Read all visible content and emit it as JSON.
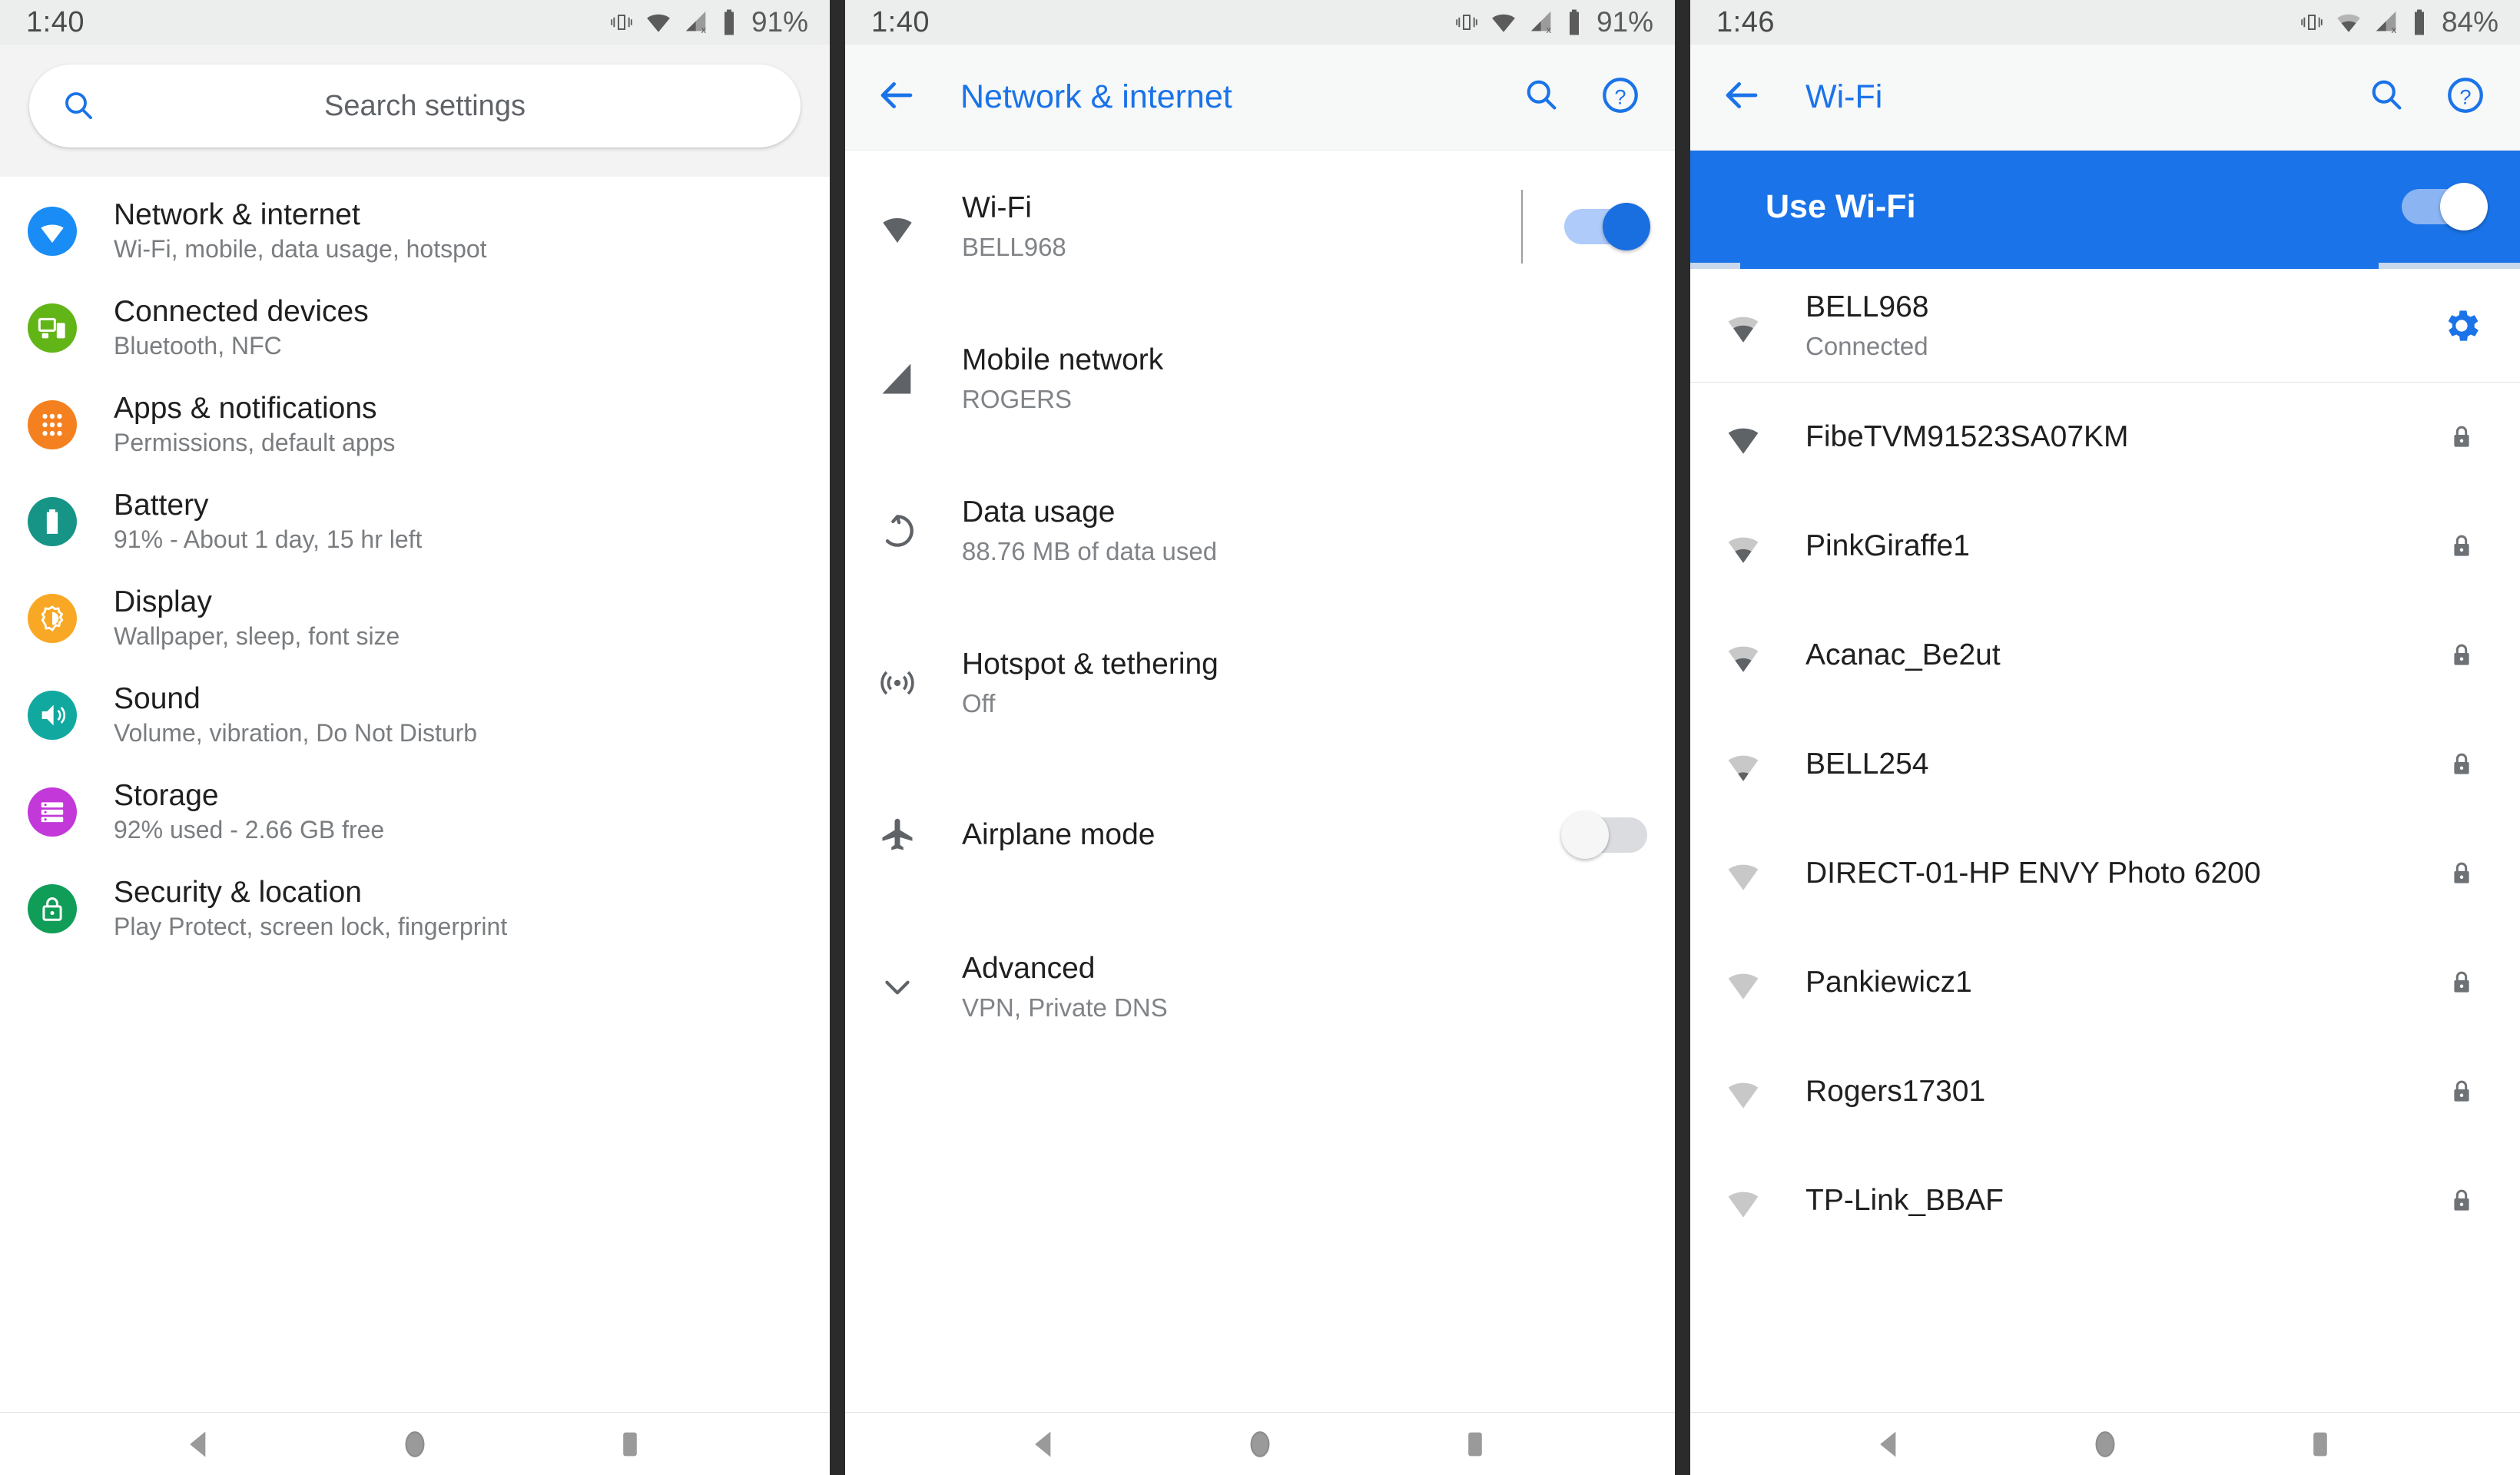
{
  "colors": {
    "accent_blue": "#1a73e8",
    "status_bar_bg": "#eceded",
    "appbar_bg": "#f7f8f8",
    "icon_network": "#1a8cf5",
    "icon_connected": "#62b517",
    "icon_apps": "#f4801f",
    "icon_battery": "#169586",
    "icon_display": "#f9a825",
    "icon_sound": "#11a8a0",
    "icon_storage": "#c238d8",
    "icon_security": "#0f9d58"
  },
  "panels": [
    {
      "id": "settings-home",
      "status_bar": {
        "time": "1:40",
        "battery": "91%",
        "icons": [
          "vibrate-icon",
          "wifi-icon",
          "cell-signal-off-icon",
          "battery-icon"
        ]
      },
      "search": {
        "placeholder": "Search settings",
        "icon": "search-icon"
      },
      "items": [
        {
          "icon": "network-icon",
          "title": "Network & internet",
          "subtitle": "Wi-Fi, mobile, data usage, hotspot"
        },
        {
          "icon": "devices-icon",
          "title": "Connected devices",
          "subtitle": "Bluetooth, NFC"
        },
        {
          "icon": "apps-icon",
          "title": "Apps & notifications",
          "subtitle": "Permissions, default apps"
        },
        {
          "icon": "battery-icon",
          "title": "Battery",
          "subtitle": "91% - About 1 day, 15 hr left"
        },
        {
          "icon": "display-icon",
          "title": "Display",
          "subtitle": "Wallpaper, sleep, font size"
        },
        {
          "icon": "sound-icon",
          "title": "Sound",
          "subtitle": "Volume, vibration, Do Not Disturb"
        },
        {
          "icon": "storage-icon",
          "title": "Storage",
          "subtitle": "92% used - 2.66 GB free"
        },
        {
          "icon": "security-icon",
          "title": "Security & location",
          "subtitle": "Play Protect, screen lock, fingerprint"
        }
      ]
    },
    {
      "id": "network-internet",
      "status_bar": {
        "time": "1:40",
        "battery": "91%"
      },
      "appbar": {
        "back": "back-arrow-icon",
        "title": "Network & internet",
        "search": "search-icon",
        "help": "help-icon"
      },
      "items": [
        {
          "icon": "wifi-icon",
          "title": "Wi-Fi",
          "subtitle": "BELL968",
          "control": "toggle",
          "toggle_on": true
        },
        {
          "icon": "signal-icon",
          "title": "Mobile network",
          "subtitle": "ROGERS",
          "control": "none"
        },
        {
          "icon": "datausage-icon",
          "title": "Data usage",
          "subtitle": "88.76 MB of data used",
          "control": "none"
        },
        {
          "icon": "hotspot-icon",
          "title": "Hotspot & tethering",
          "subtitle": "Off",
          "control": "none"
        },
        {
          "icon": "airplane-icon",
          "title": "Airplane mode",
          "subtitle": "",
          "control": "toggle",
          "toggle_on": false
        },
        {
          "icon": "chevron-down-icon",
          "title": "Advanced",
          "subtitle": "VPN, Private DNS",
          "control": "none"
        }
      ]
    },
    {
      "id": "wifi",
      "status_bar": {
        "time": "1:46",
        "battery": "84%"
      },
      "appbar": {
        "back": "back-arrow-icon",
        "title": "Wi-Fi",
        "search": "search-icon",
        "help": "help-icon"
      },
      "use_wifi": {
        "label": "Use Wi-Fi",
        "toggle_on": true
      },
      "scanning": true,
      "networks": [
        {
          "ssid": "BELL968",
          "status": "Connected",
          "signal": 3,
          "end_icon": "gear-icon",
          "secured": false
        },
        {
          "ssid": "FibeTVM91523SA07KM",
          "status": "",
          "signal": 4,
          "end_icon": "lock-icon",
          "secured": true
        },
        {
          "ssid": "PinkGiraffe1",
          "status": "",
          "signal": 2,
          "end_icon": "lock-icon",
          "secured": true
        },
        {
          "ssid": "Acanac_Be2ut",
          "status": "",
          "signal": 2,
          "end_icon": "lock-icon",
          "secured": true
        },
        {
          "ssid": "BELL254",
          "status": "",
          "signal": 1,
          "end_icon": "lock-icon",
          "secured": true
        },
        {
          "ssid": "DIRECT-01-HP ENVY Photo 6200",
          "status": "",
          "signal": 1,
          "end_icon": "lock-icon",
          "secured": true
        },
        {
          "ssid": "Pankiewicz1",
          "status": "",
          "signal": 0,
          "end_icon": "lock-icon",
          "secured": true
        },
        {
          "ssid": "Rogers17301",
          "status": "",
          "signal": 0,
          "end_icon": "lock-icon",
          "secured": true
        },
        {
          "ssid": "TP-Link_BBAF",
          "status": "",
          "signal": 0,
          "end_icon": "lock-icon",
          "secured": true
        }
      ]
    }
  ],
  "navbar": {
    "back": "nav-back-icon",
    "home": "nav-home-icon",
    "recents": "nav-recents-icon"
  }
}
